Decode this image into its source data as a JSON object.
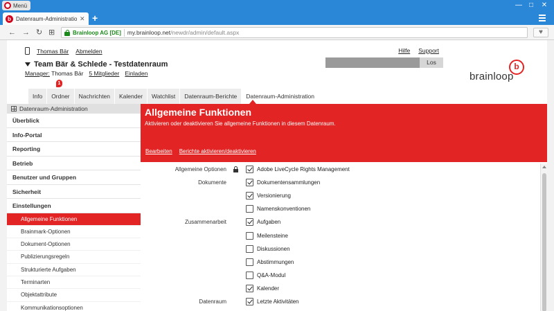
{
  "browser": {
    "menu_label": "Menü",
    "tab_title": "Datenraum-Administration",
    "tab_close": "✕",
    "new_tab": "+",
    "minimize": "—",
    "maximize": "□",
    "close": "✕",
    "back": "←",
    "forward": "→",
    "reload": "↻",
    "grid": "⊞",
    "cert": "Brainloop AG [DE]",
    "url_host": "my.brainloop.net",
    "url_path": "/newdr/admin/default.aspx",
    "heart": "♥"
  },
  "header": {
    "user": "Thomas Bär",
    "logout": "Abmelden",
    "help": "Hilfe",
    "support": "Support",
    "room_title": "Team Bär & Schlede - Testdatenraum",
    "manager_label": "Manager:",
    "manager_name": "Thomas Bär",
    "members": "5 Mitglieder",
    "invite": "Einladen",
    "search_button": "Los",
    "logo_text": "brainloop",
    "logo_letter": "b",
    "badge": "1"
  },
  "tabs": [
    "Info",
    "Ordner",
    "Nachrichten",
    "Kalender",
    "Watchlist",
    "Datenraum-Berichte",
    "Datenraum-Administration"
  ],
  "sidebar": {
    "title": "Datenraum-Administration",
    "main_items": [
      "Überblick",
      "Info-Portal",
      "Reporting",
      "Betrieb",
      "Benutzer und Gruppen",
      "Sicherheit",
      "Einstellungen"
    ],
    "sub_items": [
      "Allgemeine Funktionen",
      "Brainmark-Optionen",
      "Dokument-Optionen",
      "Publizierungsregeln",
      "Strukturierte Aufgaben",
      "Terminarten",
      "Objektattribute",
      "Kommunikationsoptionen"
    ]
  },
  "content": {
    "title": "Allgemeine Funktionen",
    "subtitle": "Aktivieren oder deaktivieren Sie allgemeine Funktionen in diesem Datenraum.",
    "action_edit": "Bearbeiten",
    "action_reports": "Berichte aktivieren/deaktivieren",
    "options": [
      {
        "group": "Allgemeine Optionen",
        "label": "Adobe LiveCycle Rights Management",
        "checked": true,
        "locked": true
      },
      {
        "group": "Dokumente",
        "label": "Dokumentensammlungen",
        "checked": true
      },
      {
        "group": "",
        "label": "Versionierung",
        "checked": true
      },
      {
        "group": "",
        "label": "Namenskonventionen",
        "checked": false
      },
      {
        "group": "Zusammenarbeit",
        "label": "Aufgaben",
        "checked": true
      },
      {
        "group": "",
        "label": "Meilensteine",
        "checked": false
      },
      {
        "group": "",
        "label": "Diskussionen",
        "checked": false
      },
      {
        "group": "",
        "label": "Abstimmungen",
        "checked": false
      },
      {
        "group": "",
        "label": "Q&A-Modul",
        "checked": false
      },
      {
        "group": "",
        "label": "Kalender",
        "checked": true
      },
      {
        "group": "Datenraum",
        "label": "Letzte Aktivitäten",
        "checked": true
      }
    ]
  },
  "colors": {
    "accent": "#e32424",
    "browser_blue": "#2a86d6"
  }
}
